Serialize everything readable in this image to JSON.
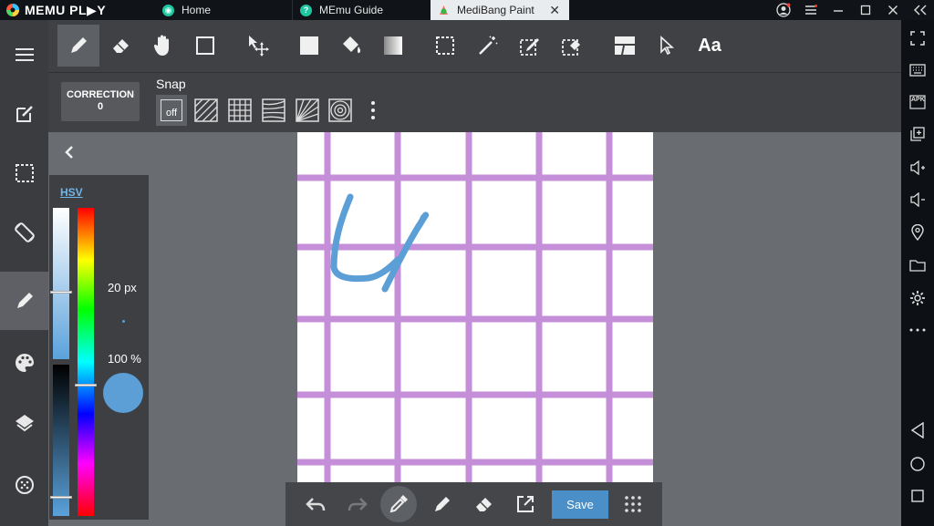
{
  "emulator": {
    "brand": "MEMU PL▶Y",
    "tabs": [
      {
        "label": "Home",
        "icon": "home-icon",
        "color": "#1fc7a0"
      },
      {
        "label": "MEmu Guide",
        "icon": "guide-icon",
        "color": "#1fc7a0"
      },
      {
        "label": "MediBang Paint",
        "icon": "medibang-icon",
        "color": "#ffffff",
        "active": true
      }
    ],
    "close_glyph": "✕",
    "window_controls": [
      "account-icon",
      "menu-icon",
      "minimize-icon",
      "maximize-icon",
      "close-icon",
      "collapse-icon"
    ],
    "sidebar_icons": [
      "fullscreen-icon",
      "keyboard-icon",
      "apk-icon",
      "add-window-icon",
      "volume-up-icon",
      "volume-down-icon",
      "location-icon",
      "folder-icon",
      "settings-icon",
      "more-icon",
      "back-icon",
      "home-circle-icon",
      "recents-icon"
    ],
    "apk_label": "APK"
  },
  "app": {
    "left_nav": [
      "menu-icon",
      "edit-page-icon",
      "selection-icon",
      "rotate-icon",
      "brush-icon",
      "palette-icon",
      "layers-icon",
      "material-icon"
    ],
    "active_left": "brush-icon",
    "toolbar": {
      "tools": [
        "brush-tool",
        "eraser-tool",
        "hand-tool",
        "rect-shape-tool",
        "move-tool",
        "fill-rect-tool",
        "bucket-tool",
        "gradient-tool",
        "select-rect-tool",
        "magic-wand-tool",
        "select-pen-tool",
        "select-eraser-tool",
        "divide-panel-tool",
        "operation-tool",
        "text-tool"
      ],
      "active": "brush-tool",
      "text_tool_label": "Aa"
    },
    "correction": {
      "label": "CORRECTION",
      "value": "0"
    },
    "snap": {
      "label": "Snap",
      "off_label": "off",
      "modes": [
        "snap-off",
        "snap-parallel",
        "snap-grid",
        "snap-perspective",
        "snap-radial",
        "snap-circle"
      ],
      "active": "snap-off"
    },
    "color_panel": {
      "mode_label": "HSV",
      "brush_size": "20 px",
      "opacity": "100 %",
      "current_color": "#5b9fd6"
    },
    "bottom_bar": {
      "tools": [
        "undo",
        "redo",
        "eyedropper",
        "pen",
        "eraser",
        "export"
      ],
      "active": "eyedropper",
      "save_label": "Save"
    }
  }
}
